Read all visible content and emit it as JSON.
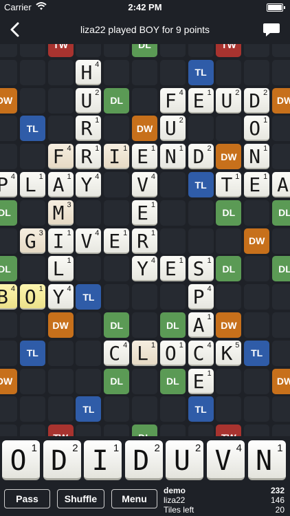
{
  "status_bar": {
    "carrier": "Carrier",
    "time": "2:42 PM"
  },
  "nav": {
    "title": "liza22 played BOY for 9 points"
  },
  "board": {
    "bonuses": [
      {
        "r": 0,
        "c": 2,
        "t": "TW"
      },
      {
        "r": 0,
        "c": 5,
        "t": "DL"
      },
      {
        "r": 0,
        "c": 8,
        "t": "TW"
      },
      {
        "r": 1,
        "c": 7,
        "t": "TL"
      },
      {
        "r": 2,
        "c": 0,
        "t": "DW"
      },
      {
        "r": 2,
        "c": 4,
        "t": "DL"
      },
      {
        "r": 2,
        "c": 10,
        "t": "DW"
      },
      {
        "r": 3,
        "c": 1,
        "t": "TL"
      },
      {
        "r": 3,
        "c": 5,
        "t": "DW"
      },
      {
        "r": 4,
        "c": 8,
        "t": "DW"
      },
      {
        "r": 5,
        "c": 7,
        "t": "TL"
      },
      {
        "r": 6,
        "c": 0,
        "t": "DL"
      },
      {
        "r": 6,
        "c": 8,
        "t": "DL"
      },
      {
        "r": 6,
        "c": 10,
        "t": "DL"
      },
      {
        "r": 7,
        "c": 9,
        "t": "DW"
      },
      {
        "r": 8,
        "c": 0,
        "t": "DL"
      },
      {
        "r": 8,
        "c": 8,
        "t": "DL"
      },
      {
        "r": 8,
        "c": 10,
        "t": "DL"
      },
      {
        "r": 9,
        "c": 3,
        "t": "TL"
      },
      {
        "r": 10,
        "c": 2,
        "t": "DW"
      },
      {
        "r": 10,
        "c": 4,
        "t": "DL"
      },
      {
        "r": 10,
        "c": 6,
        "t": "DL"
      },
      {
        "r": 10,
        "c": 8,
        "t": "DW"
      },
      {
        "r": 11,
        "c": 1,
        "t": "TL"
      },
      {
        "r": 11,
        "c": 9,
        "t": "TL"
      },
      {
        "r": 12,
        "c": 0,
        "t": "DW"
      },
      {
        "r": 12,
        "c": 4,
        "t": "DL"
      },
      {
        "r": 12,
        "c": 6,
        "t": "DL"
      },
      {
        "r": 12,
        "c": 10,
        "t": "DW"
      },
      {
        "r": 13,
        "c": 3,
        "t": "TL"
      },
      {
        "r": 13,
        "c": 7,
        "t": "TL"
      },
      {
        "r": 14,
        "c": 2,
        "t": "TW"
      },
      {
        "r": 14,
        "c": 5,
        "t": "DL"
      },
      {
        "r": 14,
        "c": 8,
        "t": "TW"
      }
    ],
    "tiles": [
      {
        "r": 1,
        "c": 3,
        "l": "H",
        "s": "4"
      },
      {
        "r": 2,
        "c": 3,
        "l": "U",
        "s": "2"
      },
      {
        "r": 2,
        "c": 6,
        "l": "F",
        "s": "4"
      },
      {
        "r": 2,
        "c": 7,
        "l": "E",
        "s": "1"
      },
      {
        "r": 2,
        "c": 8,
        "l": "U",
        "s": "2"
      },
      {
        "r": 2,
        "c": 9,
        "l": "D",
        "s": "2"
      },
      {
        "r": 3,
        "c": 3,
        "l": "R",
        "s": "1"
      },
      {
        "r": 3,
        "c": 6,
        "l": "U",
        "s": "2"
      },
      {
        "r": 3,
        "c": 9,
        "l": "O",
        "s": "1"
      },
      {
        "r": 4,
        "c": 2,
        "l": "F",
        "s": "4",
        "v": "cream"
      },
      {
        "r": 4,
        "c": 3,
        "l": "R",
        "s": "1"
      },
      {
        "r": 4,
        "c": 4,
        "l": "I",
        "s": "1",
        "v": "cream"
      },
      {
        "r": 4,
        "c": 5,
        "l": "E",
        "s": "1"
      },
      {
        "r": 4,
        "c": 6,
        "l": "N",
        "s": "1"
      },
      {
        "r": 4,
        "c": 7,
        "l": "D",
        "s": "2"
      },
      {
        "r": 4,
        "c": 9,
        "l": "N",
        "s": "1"
      },
      {
        "r": 5,
        "c": 0,
        "l": "P",
        "s": "4"
      },
      {
        "r": 5,
        "c": 1,
        "l": "L",
        "s": "1"
      },
      {
        "r": 5,
        "c": 2,
        "l": "A",
        "s": "1"
      },
      {
        "r": 5,
        "c": 3,
        "l": "Y",
        "s": "4"
      },
      {
        "r": 5,
        "c": 5,
        "l": "V",
        "s": "4"
      },
      {
        "r": 5,
        "c": 8,
        "l": "T",
        "s": "1"
      },
      {
        "r": 5,
        "c": 9,
        "l": "E",
        "s": "1"
      },
      {
        "r": 5,
        "c": 10,
        "l": "A",
        "s": "1"
      },
      {
        "r": 6,
        "c": 2,
        "l": "M",
        "s": "3",
        "v": "cream"
      },
      {
        "r": 6,
        "c": 5,
        "l": "E",
        "s": "1"
      },
      {
        "r": 7,
        "c": 1,
        "l": "G",
        "s": "3",
        "v": "cream"
      },
      {
        "r": 7,
        "c": 2,
        "l": "I",
        "s": "1"
      },
      {
        "r": 7,
        "c": 3,
        "l": "V",
        "s": "4"
      },
      {
        "r": 7,
        "c": 4,
        "l": "E",
        "s": "1"
      },
      {
        "r": 7,
        "c": 5,
        "l": "R",
        "s": "1"
      },
      {
        "r": 8,
        "c": 2,
        "l": "L",
        "s": "1"
      },
      {
        "r": 8,
        "c": 5,
        "l": "Y",
        "s": "4"
      },
      {
        "r": 8,
        "c": 6,
        "l": "E",
        "s": "1"
      },
      {
        "r": 8,
        "c": 7,
        "l": "S",
        "s": "1"
      },
      {
        "r": 9,
        "c": 0,
        "l": "B",
        "s": "4",
        "v": "yellow"
      },
      {
        "r": 9,
        "c": 1,
        "l": "O",
        "s": "1",
        "v": "yellow"
      },
      {
        "r": 9,
        "c": 2,
        "l": "Y",
        "s": "4"
      },
      {
        "r": 9,
        "c": 7,
        "l": "P",
        "s": "4"
      },
      {
        "r": 10,
        "c": 7,
        "l": "A",
        "s": "1"
      },
      {
        "r": 11,
        "c": 4,
        "l": "C",
        "s": "4"
      },
      {
        "r": 11,
        "c": 5,
        "l": "L",
        "s": "1",
        "v": "cream"
      },
      {
        "r": 11,
        "c": 6,
        "l": "O",
        "s": "1"
      },
      {
        "r": 11,
        "c": 7,
        "l": "C",
        "s": "4"
      },
      {
        "r": 11,
        "c": 8,
        "l": "K",
        "s": "5"
      },
      {
        "r": 12,
        "c": 7,
        "l": "E",
        "s": "1"
      }
    ]
  },
  "rack": [
    {
      "l": "O",
      "s": "1"
    },
    {
      "l": "D",
      "s": "2"
    },
    {
      "l": "I",
      "s": "1"
    },
    {
      "l": "D",
      "s": "2"
    },
    {
      "l": "U",
      "s": "2"
    },
    {
      "l": "V",
      "s": "4"
    },
    {
      "l": "N",
      "s": "1"
    }
  ],
  "controls": {
    "pass": "Pass",
    "shuffle": "Shuffle",
    "menu": "Menu"
  },
  "scores": {
    "players": [
      {
        "name": "demo",
        "score": "232"
      },
      {
        "name": "liza22",
        "score": "146"
      }
    ],
    "tiles_left_label": "Tiles left",
    "tiles_left": "20"
  }
}
